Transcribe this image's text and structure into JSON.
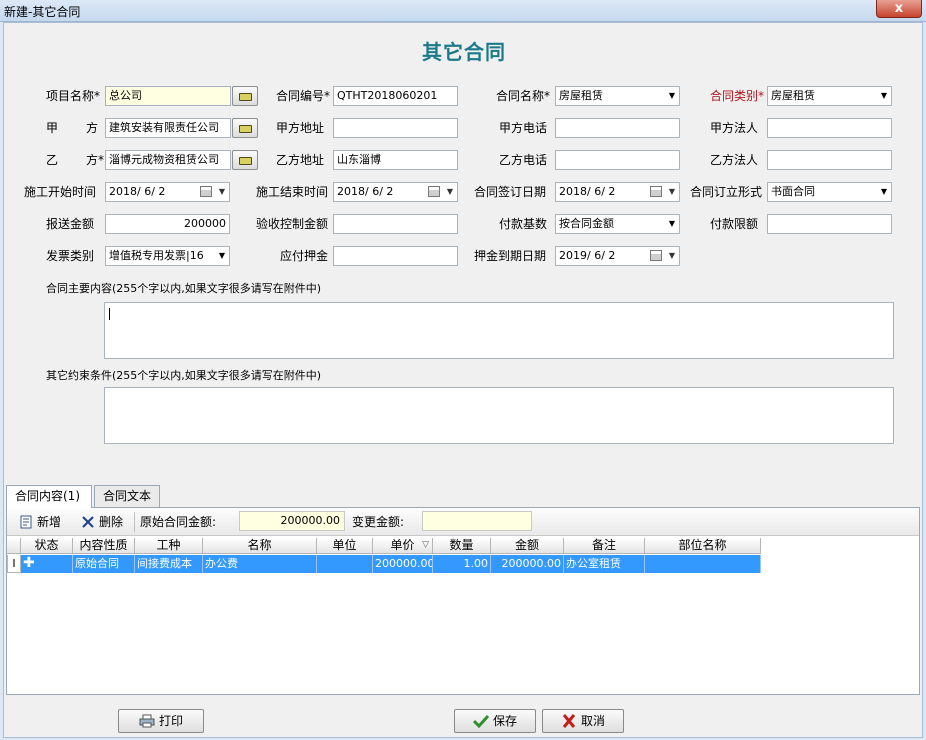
{
  "window": {
    "title": "新建-其它合同",
    "close_glyph": "x"
  },
  "heading": "其它合同",
  "form": {
    "project_name_label": "项目名称",
    "project_name_value": "总公司",
    "contract_no_label": "合同编号",
    "contract_no_value": "QTHT2018060201",
    "contract_name_label": "合同名称",
    "contract_name_value": "房屋租赁",
    "contract_type_label": "合同类别",
    "contract_type_value": "房屋租赁",
    "party_a_label_1": "甲",
    "party_a_label_2": "方",
    "party_a_value": "建筑安装有限责任公司",
    "party_a_addr_label": "甲方地址",
    "party_a_addr_value": "",
    "party_a_phone_label": "甲方电话",
    "party_a_phone_value": "",
    "party_a_legal_label": "甲方法人",
    "party_a_legal_value": "",
    "party_b_label_1": "乙",
    "party_b_label_2": "方",
    "party_b_value": "淄博元成物资租赁公司",
    "party_b_addr_label": "乙方地址",
    "party_b_addr_value": "山东淄博",
    "party_b_phone_label": "乙方电话",
    "party_b_phone_value": "",
    "party_b_legal_label": "乙方法人",
    "party_b_legal_value": "",
    "start_date_label": "施工开始时间",
    "start_date_value": "2018/ 6/ 2",
    "end_date_label": "施工结束时间",
    "end_date_value": "2018/ 6/ 2",
    "sign_date_label": "合同签订日期",
    "sign_date_value": "2018/ 6/ 2",
    "sign_form_label": "合同订立形式",
    "sign_form_value": "书面合同",
    "report_amount_label": "报送金额",
    "report_amount_value": "200000",
    "acceptance_amount_label": "验收控制金额",
    "acceptance_amount_value": "",
    "payment_base_label": "付款基数",
    "payment_base_value": "按合同金额",
    "payment_limit_label": "付款限额",
    "payment_limit_value": "",
    "invoice_type_label": "发票类别",
    "invoice_type_value": "增值税专用发票|16",
    "deposit_label": "应付押金",
    "deposit_value": "",
    "deposit_due_label": "押金到期日期",
    "deposit_due_value": "2019/ 6/ 2",
    "main_content_label": "合同主要内容(255个字以内,如果文字很多请写在附件中)",
    "main_content_value": "",
    "other_terms_label": "其它约束条件(255个字以内,如果文字很多请写在附件中)",
    "other_terms_value": "",
    "required_mark": "*"
  },
  "tabs": [
    {
      "label": "合同内容(1)",
      "active": true
    },
    {
      "label": "合同文本",
      "active": false
    }
  ],
  "toolbar": {
    "add_label": "新增",
    "delete_label": "删除",
    "original_amount_label": "原始合同金额:",
    "original_amount_value": "200000.00",
    "change_amount_label": "变更金额:",
    "change_amount_value": ""
  },
  "grid": {
    "columns": [
      "状态",
      "内容性质",
      "工种",
      "名称",
      "单位",
      "单价",
      "数量",
      "金额",
      "备注",
      "部位名称"
    ],
    "sort_glyph": "▽",
    "row_indicator": "I",
    "rows": [
      {
        "status_icon": "plus-icon",
        "nature": "原始合同",
        "work_type": "间接费成本",
        "name": "办公费",
        "unit": "",
        "price": "200000.00",
        "qty": "1.00",
        "amount": "200000.00",
        "remark": "办公室租赁",
        "location": ""
      }
    ]
  },
  "buttons": {
    "print_label": "打印",
    "save_label": "保存",
    "cancel_label": "取消"
  },
  "colors": {
    "accent_heading": "#1b7a8a",
    "required_red": "#b0141c",
    "selection_blue": "#3399ff",
    "yellow_field": "#ffffe1"
  }
}
